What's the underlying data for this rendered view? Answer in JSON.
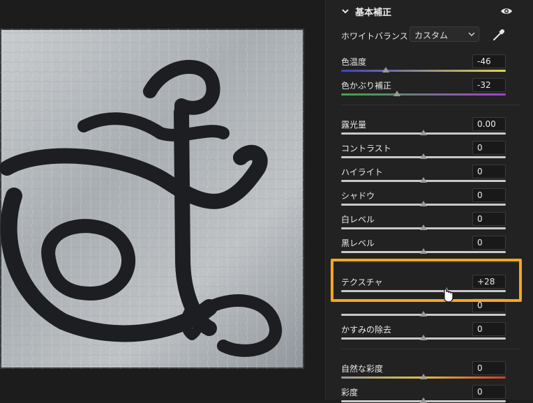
{
  "panel": {
    "section_title": "基本補正",
    "white_balance": {
      "label": "ホワイトバランス",
      "value": "カスタム"
    },
    "color_sliders": [
      {
        "label": "色温度",
        "value": "-46",
        "level": 0.27
      },
      {
        "label": "色かぶり補正",
        "value": "-32",
        "level": 0.34
      }
    ],
    "tone_sliders": [
      {
        "label": "露光量",
        "value": "0.00",
        "level": 0.5
      },
      {
        "label": "コントラスト",
        "value": "0",
        "level": 0.5
      },
      {
        "label": "ハイライト",
        "value": "0",
        "level": 0.5
      },
      {
        "label": "シャドウ",
        "value": "0",
        "level": 0.5
      },
      {
        "label": "白レベル",
        "value": "0",
        "level": 0.5
      },
      {
        "label": "黒レベル",
        "value": "0",
        "level": 0.5
      }
    ],
    "presence_sliders": [
      {
        "label": "テクスチャ",
        "value": "+28",
        "level": 0.64
      },
      {
        "label": "",
        "value": "0",
        "level": 0.5
      },
      {
        "label": "かすみの除去",
        "value": "0",
        "level": 0.5
      }
    ],
    "color_sat_sliders": [
      {
        "label": "自然な彩度",
        "value": "0",
        "level": 0.5
      },
      {
        "label": "彩度",
        "value": "0",
        "level": 0.5
      }
    ]
  },
  "colors": {
    "highlight": "#f5a623",
    "temp_gradient": [
      "#3a44c8",
      "#e2d64a"
    ],
    "tint_gradient": [
      "#3fa64a",
      "#a442c9"
    ],
    "vibrance_gradient": [
      "#9a9a9a",
      "#e0c040",
      "#d03a2a"
    ]
  },
  "icons": [
    "chevron-down-icon",
    "eye-icon",
    "eyedropper-icon",
    "cursor-icon"
  ]
}
